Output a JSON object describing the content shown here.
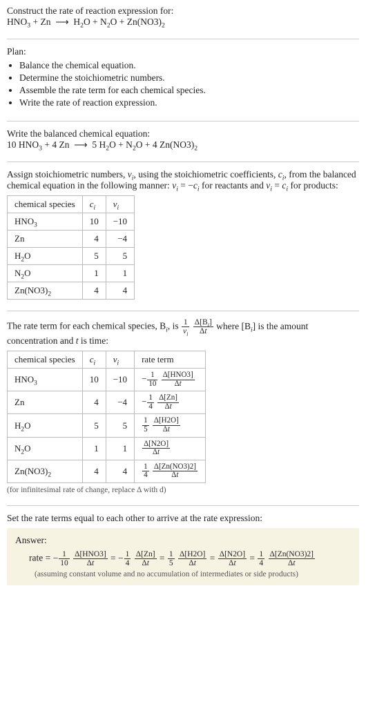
{
  "prompt": {
    "title": "Construct the rate of reaction expression for:",
    "equation_html": "HNO<sub>3</sub> + Zn &nbsp;⟶&nbsp; H<sub>2</sub>O + N<sub>2</sub>O + Zn(NO3)<sub>2</sub>"
  },
  "plan": {
    "heading": "Plan:",
    "items": [
      "Balance the chemical equation.",
      "Determine the stoichiometric numbers.",
      "Assemble the rate term for each chemical species.",
      "Write the rate of reaction expression."
    ]
  },
  "balanced": {
    "heading": "Write the balanced chemical equation:",
    "equation_html": "10 HNO<sub>3</sub> + 4 Zn &nbsp;⟶&nbsp; 5 H<sub>2</sub>O + N<sub>2</sub>O + 4 Zn(NO3)<sub>2</sub>"
  },
  "stoich": {
    "intro_html": "Assign stoichiometric numbers, <span class='ital'>ν<sub>i</sub></span>, using the stoichiometric coefficients, <span class='ital'>c<sub>i</sub></span>, from the balanced chemical equation in the following manner: <span class='ital'>ν<sub>i</sub></span> = −<span class='ital'>c<sub>i</sub></span> for reactants and <span class='ital'>ν<sub>i</sub></span> = <span class='ital'>c<sub>i</sub></span> for products:",
    "headers": [
      "chemical species",
      "c_i",
      "ν_i"
    ],
    "rows": [
      {
        "species_html": "HNO<sub>3</sub>",
        "c": "10",
        "nu": "−10"
      },
      {
        "species_html": "Zn",
        "c": "4",
        "nu": "−4"
      },
      {
        "species_html": "H<sub>2</sub>O",
        "c": "5",
        "nu": "5"
      },
      {
        "species_html": "N<sub>2</sub>O",
        "c": "1",
        "nu": "1"
      },
      {
        "species_html": "Zn(NO3)<sub>2</sub>",
        "c": "4",
        "nu": "4"
      }
    ]
  },
  "rate_terms": {
    "intro_pre": "The rate term for each chemical species, B",
    "intro_mid": ", is ",
    "intro_post_html": " where [B<sub><i>i</i></sub>] is the amount concentration and <span class='ital'>t</span> is time:",
    "headers": [
      "chemical species",
      "c_i",
      "ν_i",
      "rate term"
    ],
    "rows": [
      {
        "species_html": "HNO<sub>3</sub>",
        "c": "10",
        "nu": "−10",
        "term_num": "Δ[HNO3]",
        "coef_num": "1",
        "coef_den": "10",
        "neg": true
      },
      {
        "species_html": "Zn",
        "c": "4",
        "nu": "−4",
        "term_num": "Δ[Zn]",
        "coef_num": "1",
        "coef_den": "4",
        "neg": true
      },
      {
        "species_html": "H<sub>2</sub>O",
        "c": "5",
        "nu": "5",
        "term_num": "Δ[H2O]",
        "coef_num": "1",
        "coef_den": "5",
        "neg": false
      },
      {
        "species_html": "N<sub>2</sub>O",
        "c": "1",
        "nu": "1",
        "term_num": "Δ[N2O]",
        "coef_num": "",
        "coef_den": "",
        "neg": false
      },
      {
        "species_html": "Zn(NO3)<sub>2</sub>",
        "c": "4",
        "nu": "4",
        "term_num": "Δ[Zn(NO3)2]",
        "coef_num": "1",
        "coef_den": "4",
        "neg": false
      }
    ],
    "footnote": "(for infinitesimal rate of change, replace Δ with d)"
  },
  "final": {
    "heading": "Set the rate terms equal to each other to arrive at the rate expression:",
    "answer_label": "Answer:",
    "rate_prefix": "rate = ",
    "assumption": "(assuming constant volume and no accumulation of intermediates or side products)"
  },
  "chart_data": {
    "type": "table",
    "tables": [
      {
        "title": "stoichiometric numbers",
        "columns": [
          "chemical species",
          "c_i",
          "nu_i"
        ],
        "rows": [
          [
            "HNO3",
            10,
            -10
          ],
          [
            "Zn",
            4,
            -4
          ],
          [
            "H2O",
            5,
            5
          ],
          [
            "N2O",
            1,
            1
          ],
          [
            "Zn(NO3)2",
            4,
            4
          ]
        ]
      },
      {
        "title": "rate terms",
        "columns": [
          "chemical species",
          "c_i",
          "nu_i",
          "rate term"
        ],
        "rows": [
          [
            "HNO3",
            10,
            -10,
            "-(1/10) d[HNO3]/dt"
          ],
          [
            "Zn",
            4,
            -4,
            "-(1/4) d[Zn]/dt"
          ],
          [
            "H2O",
            5,
            5,
            "(1/5) d[H2O]/dt"
          ],
          [
            "N2O",
            1,
            1,
            "d[N2O]/dt"
          ],
          [
            "Zn(NO3)2",
            4,
            4,
            "(1/4) d[Zn(NO3)2]/dt"
          ]
        ]
      }
    ],
    "rate_expression": "rate = -(1/10) d[HNO3]/dt = -(1/4) d[Zn]/dt = (1/5) d[H2O]/dt = d[N2O]/dt = (1/4) d[Zn(NO3)2]/dt"
  }
}
